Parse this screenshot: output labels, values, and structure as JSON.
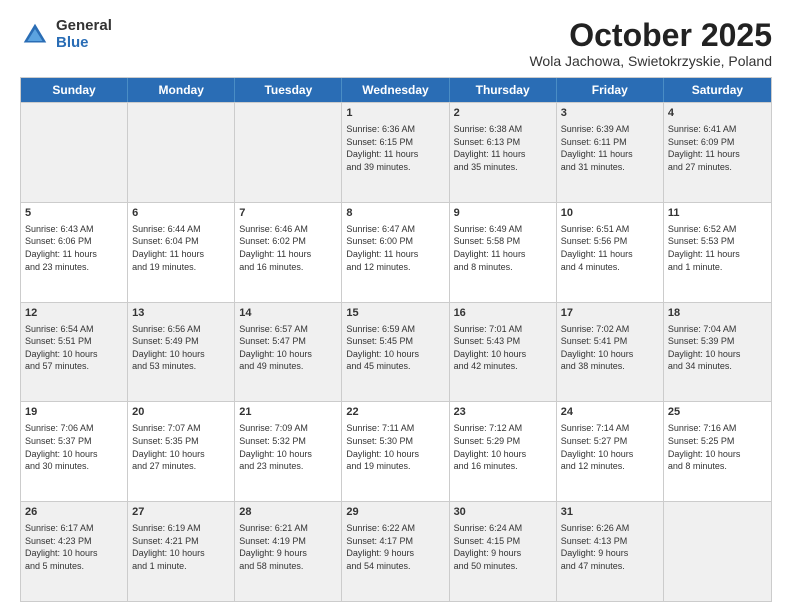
{
  "logo": {
    "general": "General",
    "blue": "Blue"
  },
  "title": "October 2025",
  "subtitle": "Wola Jachowa, Swietokrzyskie, Poland",
  "days": [
    "Sunday",
    "Monday",
    "Tuesday",
    "Wednesday",
    "Thursday",
    "Friday",
    "Saturday"
  ],
  "weeks": [
    [
      {
        "day": "",
        "info": ""
      },
      {
        "day": "",
        "info": ""
      },
      {
        "day": "",
        "info": ""
      },
      {
        "day": "1",
        "info": "Sunrise: 6:36 AM\nSunset: 6:15 PM\nDaylight: 11 hours\nand 39 minutes."
      },
      {
        "day": "2",
        "info": "Sunrise: 6:38 AM\nSunset: 6:13 PM\nDaylight: 11 hours\nand 35 minutes."
      },
      {
        "day": "3",
        "info": "Sunrise: 6:39 AM\nSunset: 6:11 PM\nDaylight: 11 hours\nand 31 minutes."
      },
      {
        "day": "4",
        "info": "Sunrise: 6:41 AM\nSunset: 6:09 PM\nDaylight: 11 hours\nand 27 minutes."
      }
    ],
    [
      {
        "day": "5",
        "info": "Sunrise: 6:43 AM\nSunset: 6:06 PM\nDaylight: 11 hours\nand 23 minutes."
      },
      {
        "day": "6",
        "info": "Sunrise: 6:44 AM\nSunset: 6:04 PM\nDaylight: 11 hours\nand 19 minutes."
      },
      {
        "day": "7",
        "info": "Sunrise: 6:46 AM\nSunset: 6:02 PM\nDaylight: 11 hours\nand 16 minutes."
      },
      {
        "day": "8",
        "info": "Sunrise: 6:47 AM\nSunset: 6:00 PM\nDaylight: 11 hours\nand 12 minutes."
      },
      {
        "day": "9",
        "info": "Sunrise: 6:49 AM\nSunset: 5:58 PM\nDaylight: 11 hours\nand 8 minutes."
      },
      {
        "day": "10",
        "info": "Sunrise: 6:51 AM\nSunset: 5:56 PM\nDaylight: 11 hours\nand 4 minutes."
      },
      {
        "day": "11",
        "info": "Sunrise: 6:52 AM\nSunset: 5:53 PM\nDaylight: 11 hours\nand 1 minute."
      }
    ],
    [
      {
        "day": "12",
        "info": "Sunrise: 6:54 AM\nSunset: 5:51 PM\nDaylight: 10 hours\nand 57 minutes."
      },
      {
        "day": "13",
        "info": "Sunrise: 6:56 AM\nSunset: 5:49 PM\nDaylight: 10 hours\nand 53 minutes."
      },
      {
        "day": "14",
        "info": "Sunrise: 6:57 AM\nSunset: 5:47 PM\nDaylight: 10 hours\nand 49 minutes."
      },
      {
        "day": "15",
        "info": "Sunrise: 6:59 AM\nSunset: 5:45 PM\nDaylight: 10 hours\nand 45 minutes."
      },
      {
        "day": "16",
        "info": "Sunrise: 7:01 AM\nSunset: 5:43 PM\nDaylight: 10 hours\nand 42 minutes."
      },
      {
        "day": "17",
        "info": "Sunrise: 7:02 AM\nSunset: 5:41 PM\nDaylight: 10 hours\nand 38 minutes."
      },
      {
        "day": "18",
        "info": "Sunrise: 7:04 AM\nSunset: 5:39 PM\nDaylight: 10 hours\nand 34 minutes."
      }
    ],
    [
      {
        "day": "19",
        "info": "Sunrise: 7:06 AM\nSunset: 5:37 PM\nDaylight: 10 hours\nand 30 minutes."
      },
      {
        "day": "20",
        "info": "Sunrise: 7:07 AM\nSunset: 5:35 PM\nDaylight: 10 hours\nand 27 minutes."
      },
      {
        "day": "21",
        "info": "Sunrise: 7:09 AM\nSunset: 5:32 PM\nDaylight: 10 hours\nand 23 minutes."
      },
      {
        "day": "22",
        "info": "Sunrise: 7:11 AM\nSunset: 5:30 PM\nDaylight: 10 hours\nand 19 minutes."
      },
      {
        "day": "23",
        "info": "Sunrise: 7:12 AM\nSunset: 5:29 PM\nDaylight: 10 hours\nand 16 minutes."
      },
      {
        "day": "24",
        "info": "Sunrise: 7:14 AM\nSunset: 5:27 PM\nDaylight: 10 hours\nand 12 minutes."
      },
      {
        "day": "25",
        "info": "Sunrise: 7:16 AM\nSunset: 5:25 PM\nDaylight: 10 hours\nand 8 minutes."
      }
    ],
    [
      {
        "day": "26",
        "info": "Sunrise: 6:17 AM\nSunset: 4:23 PM\nDaylight: 10 hours\nand 5 minutes."
      },
      {
        "day": "27",
        "info": "Sunrise: 6:19 AM\nSunset: 4:21 PM\nDaylight: 10 hours\nand 1 minute."
      },
      {
        "day": "28",
        "info": "Sunrise: 6:21 AM\nSunset: 4:19 PM\nDaylight: 9 hours\nand 58 minutes."
      },
      {
        "day": "29",
        "info": "Sunrise: 6:22 AM\nSunset: 4:17 PM\nDaylight: 9 hours\nand 54 minutes."
      },
      {
        "day": "30",
        "info": "Sunrise: 6:24 AM\nSunset: 4:15 PM\nDaylight: 9 hours\nand 50 minutes."
      },
      {
        "day": "31",
        "info": "Sunrise: 6:26 AM\nSunset: 4:13 PM\nDaylight: 9 hours\nand 47 minutes."
      },
      {
        "day": "",
        "info": ""
      }
    ]
  ]
}
